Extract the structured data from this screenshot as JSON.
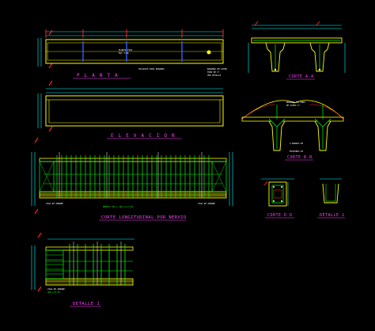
{
  "drawing": {
    "background": "#000000",
    "colors": {
      "beam_outline": "#ffff00",
      "dimension": "#00ffff",
      "rebar": "#00ff00",
      "section_cut": "#ff2020",
      "title": "#ff40ff",
      "annotation": "#ffffff",
      "stirrup": "#3060ff"
    },
    "views": {
      "planta": {
        "title": "P L A N T A"
      },
      "elevacion": {
        "title": "E L E V A C I O N"
      },
      "corte_longitudinal": {
        "title": "CORTE LONGITUDINAL POR NERVIO"
      },
      "detalle_1": {
        "title": "DETALLE 1"
      },
      "corte_aa": {
        "title": "CORTE A-A"
      },
      "corte_bb": {
        "title": "CORTE B-B"
      },
      "corte_dd": {
        "title": "CORTE D-D"
      },
      "detalle_2": {
        "title": "DETALLE 2"
      }
    }
  }
}
